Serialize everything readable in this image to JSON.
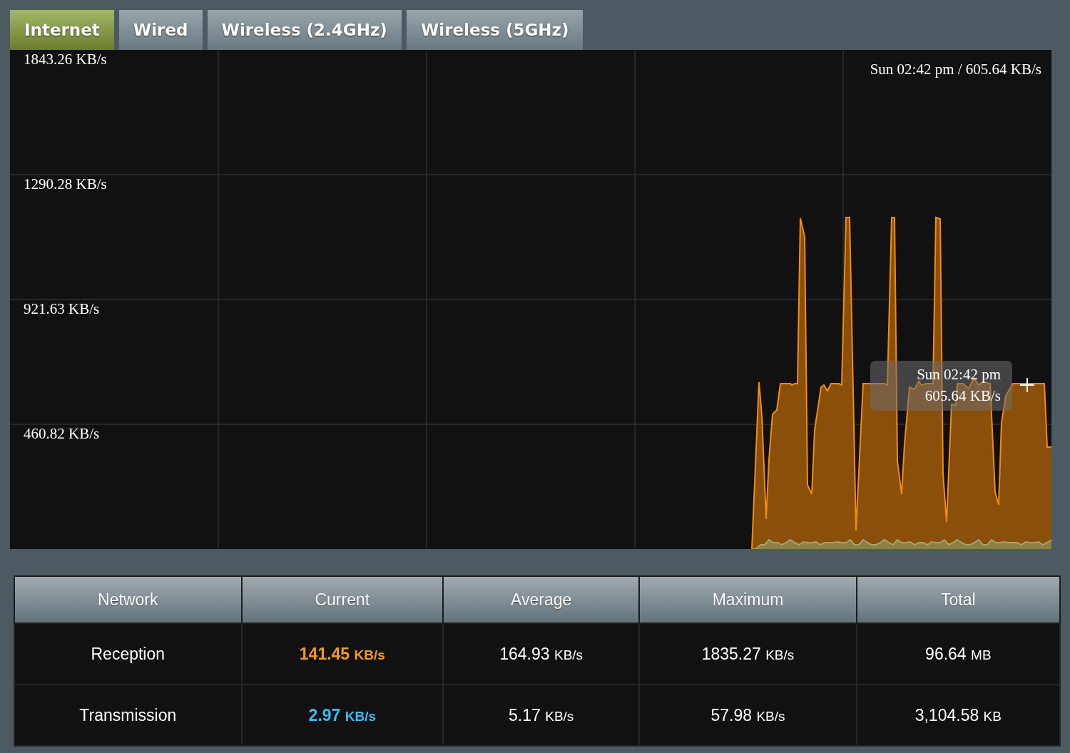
{
  "tabs": [
    {
      "label": "Internet",
      "selected": true
    },
    {
      "label": "Wired",
      "selected": false
    },
    {
      "label": "Wireless (2.4GHz)",
      "selected": false
    },
    {
      "label": "Wireless (5GHz)",
      "selected": false
    }
  ],
  "chart": {
    "y_labels": [
      "1843.26 KB/s",
      "1290.28 KB/s",
      "921.63 KB/s",
      "460.82 KB/s"
    ],
    "readout": "Sun 02:42 pm / 605.64 KB/s",
    "tooltip": {
      "time": "Sun 02:42 pm",
      "value": "605.64 KB/s"
    }
  },
  "table": {
    "columns": [
      "Network",
      "Current",
      "Average",
      "Maximum",
      "Total"
    ],
    "rows": [
      {
        "cells": [
          {
            "value": "Reception"
          },
          {
            "value": "141.45",
            "unit": "KB/s",
            "color": "#f39a1c"
          },
          {
            "value": "164.93",
            "unit": "KB/s"
          },
          {
            "value": "1835.27",
            "unit": "KB/s"
          },
          {
            "value": "96.64",
            "unit": "MB"
          }
        ]
      },
      {
        "cells": [
          {
            "value": "Transmission"
          },
          {
            "value": "2.97",
            "unit": "KB/s",
            "color": "#38bdf0"
          },
          {
            "value": "5.17",
            "unit": "KB/s"
          },
          {
            "value": "57.98",
            "unit": "KB/s"
          },
          {
            "value": "3,104.58",
            "unit": "KB"
          }
        ]
      }
    ]
  }
}
